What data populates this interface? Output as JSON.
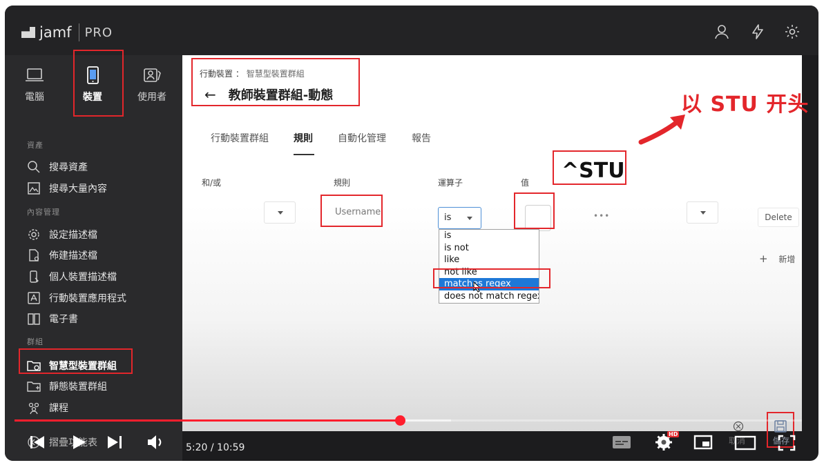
{
  "app": {
    "brand": "jamf",
    "product": "PRO"
  },
  "nav_tabs": [
    {
      "id": "computers",
      "label": "電腦",
      "icon": "laptop-icon"
    },
    {
      "id": "devices",
      "label": "裝置",
      "icon": "mobile-device-icon"
    },
    {
      "id": "users",
      "label": "使用者",
      "icon": "users-icon"
    }
  ],
  "sidebar": {
    "sections": [
      {
        "label": "資產",
        "items": [
          {
            "label": "搜尋資產",
            "icon": "search-icon"
          },
          {
            "label": "搜尋大量內容",
            "icon": "image-icon"
          }
        ]
      },
      {
        "label": "內容管理",
        "items": [
          {
            "label": "設定描述檔",
            "icon": "gear-icon"
          },
          {
            "label": "佈建描述檔",
            "icon": "profile-icon"
          },
          {
            "label": "個人裝置描述檔",
            "icon": "personal-device-icon"
          },
          {
            "label": "行動裝置應用程式",
            "icon": "app-store-icon"
          },
          {
            "label": "電子書",
            "icon": "book-icon"
          }
        ]
      },
      {
        "label": "群組",
        "items": [
          {
            "label": "智慧型裝置群組",
            "icon": "smart-folder-icon"
          },
          {
            "label": "靜態裝置群組",
            "icon": "static-folder-icon"
          },
          {
            "label": "課程",
            "icon": "classes-icon"
          }
        ]
      }
    ],
    "collapse_label": "摺疊功能表"
  },
  "breadcrumb": {
    "parent": "行動裝置",
    "separator": "：",
    "current": "智慧型裝置群組"
  },
  "page_title": "教師裝置群組-動態",
  "tabs": [
    "行動裝置群組",
    "規則",
    "自動化管理",
    "報告"
  ],
  "active_tab": "規則",
  "columns": {
    "and_or": "和/或",
    "criteria": "規則",
    "operator": "運算子",
    "value": "值"
  },
  "criteria_row": {
    "criteria_value": "Username",
    "operator_value": "is",
    "value_value": "",
    "more": "•••",
    "delete_label": "Delete"
  },
  "operator_options": [
    "is",
    "is not",
    "like",
    "not like",
    "matches regex",
    "does not match regex"
  ],
  "selected_option": "matches regex",
  "add_label": "新增",
  "annotations": {
    "stu_note": "以 STU 开头",
    "regex_value": "^STU"
  },
  "player": {
    "time": "5:20 / 10:59",
    "cancel_label": "取消",
    "save_label": "儲存",
    "hd_badge": "HD"
  },
  "colors": {
    "accent_red": "#e3262b",
    "progress_red": "#ff1e2d",
    "select_blue": "#1e78d7"
  }
}
